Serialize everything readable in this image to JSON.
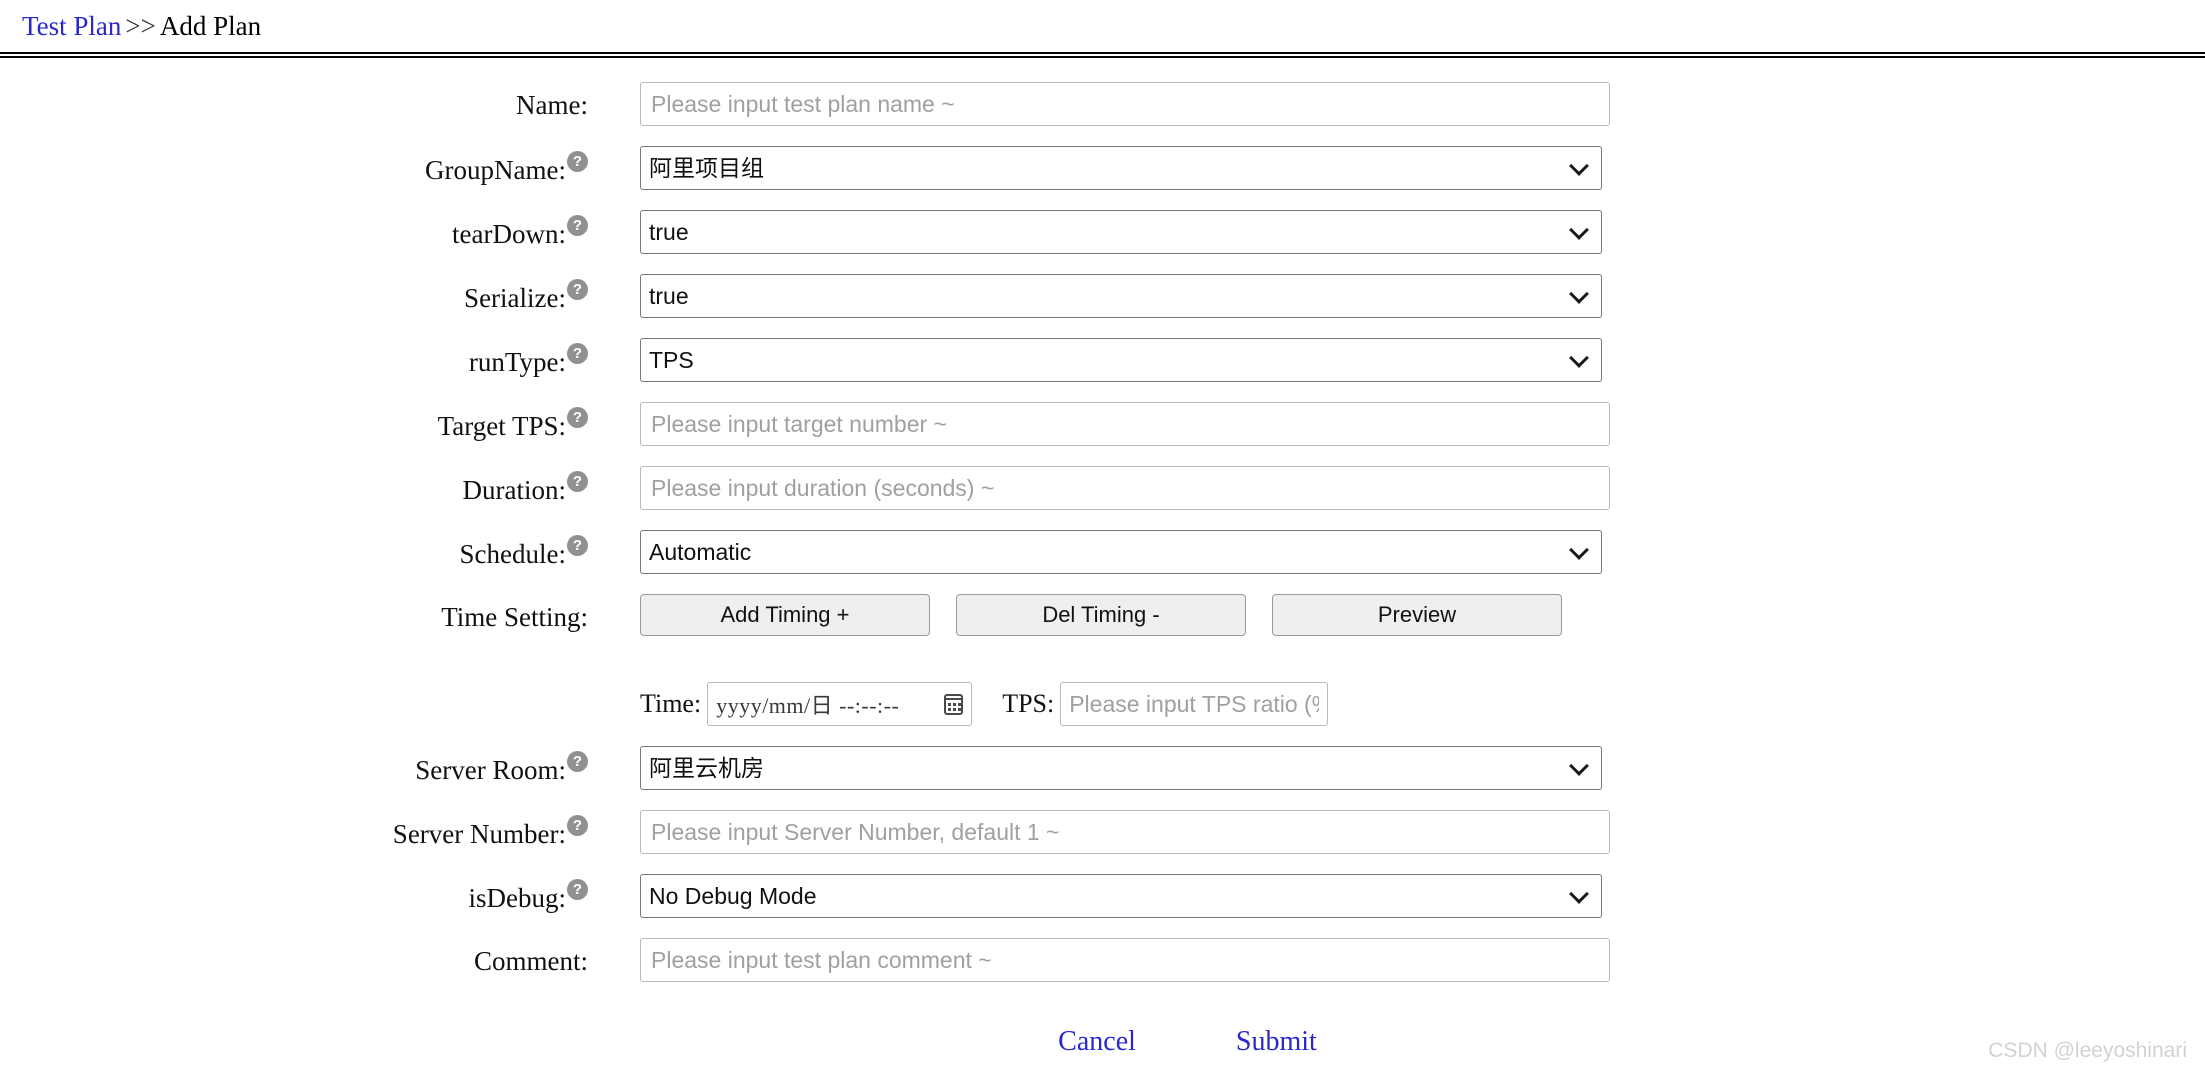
{
  "breadcrumb": {
    "parent": "Test Plan",
    "separator": ">>",
    "current": "Add Plan"
  },
  "help_icon_glyph": "?",
  "form": {
    "rows": [
      {
        "label": "Name:",
        "help": false,
        "type": "text",
        "placeholder": "Please input test plan name ~",
        "value": ""
      },
      {
        "label": "GroupName:",
        "help": true,
        "type": "select",
        "value": "阿里项目组"
      },
      {
        "label": "tearDown:",
        "help": true,
        "type": "select",
        "value": "true"
      },
      {
        "label": "Serialize:",
        "help": true,
        "type": "select",
        "value": "true"
      },
      {
        "label": "runType:",
        "help": true,
        "type": "select",
        "value": "TPS"
      },
      {
        "label": "Target TPS:",
        "help": true,
        "type": "text",
        "placeholder": "Please input target number ~",
        "value": ""
      },
      {
        "label": "Duration:",
        "help": true,
        "type": "text",
        "placeholder": "Please input duration (seconds) ~",
        "value": ""
      },
      {
        "label": "Schedule:",
        "help": true,
        "type": "select",
        "value": "Automatic"
      },
      {
        "label": "Time Setting:",
        "help": false,
        "type": "buttons"
      },
      {
        "label": "Server Room:",
        "help": true,
        "type": "select",
        "value": "阿里云机房"
      },
      {
        "label": "Server Number:",
        "help": true,
        "type": "text",
        "placeholder": "Please input Server Number, default 1 ~",
        "value": ""
      },
      {
        "label": "isDebug:",
        "help": true,
        "type": "select",
        "value": "No Debug Mode"
      },
      {
        "label": "Comment:",
        "help": false,
        "type": "text",
        "placeholder": "Please input test plan comment ~",
        "value": ""
      }
    ],
    "time_setting": {
      "add_button": "Add Timing +",
      "del_button": "Del Timing -",
      "preview_button": "Preview",
      "time_label": "Time:",
      "datetime_date_placeholder": "yyyy/mm/日",
      "datetime_time_placeholder": "--:--:--",
      "datetime_value": "",
      "calendar_icon": "calendar-icon",
      "tps_label": "TPS:",
      "tps_placeholder": "Please input TPS ratio (%)",
      "tps_value": ""
    }
  },
  "actions": {
    "cancel": "Cancel",
    "submit": "Submit"
  },
  "watermark": "CSDN @leeyoshinari",
  "colors": {
    "link": "#2a28cc",
    "help_icon_bg": "#909090",
    "button_bg": "#efefef",
    "placeholder": "#a0a0a0",
    "watermark": "#d2d2d2"
  }
}
